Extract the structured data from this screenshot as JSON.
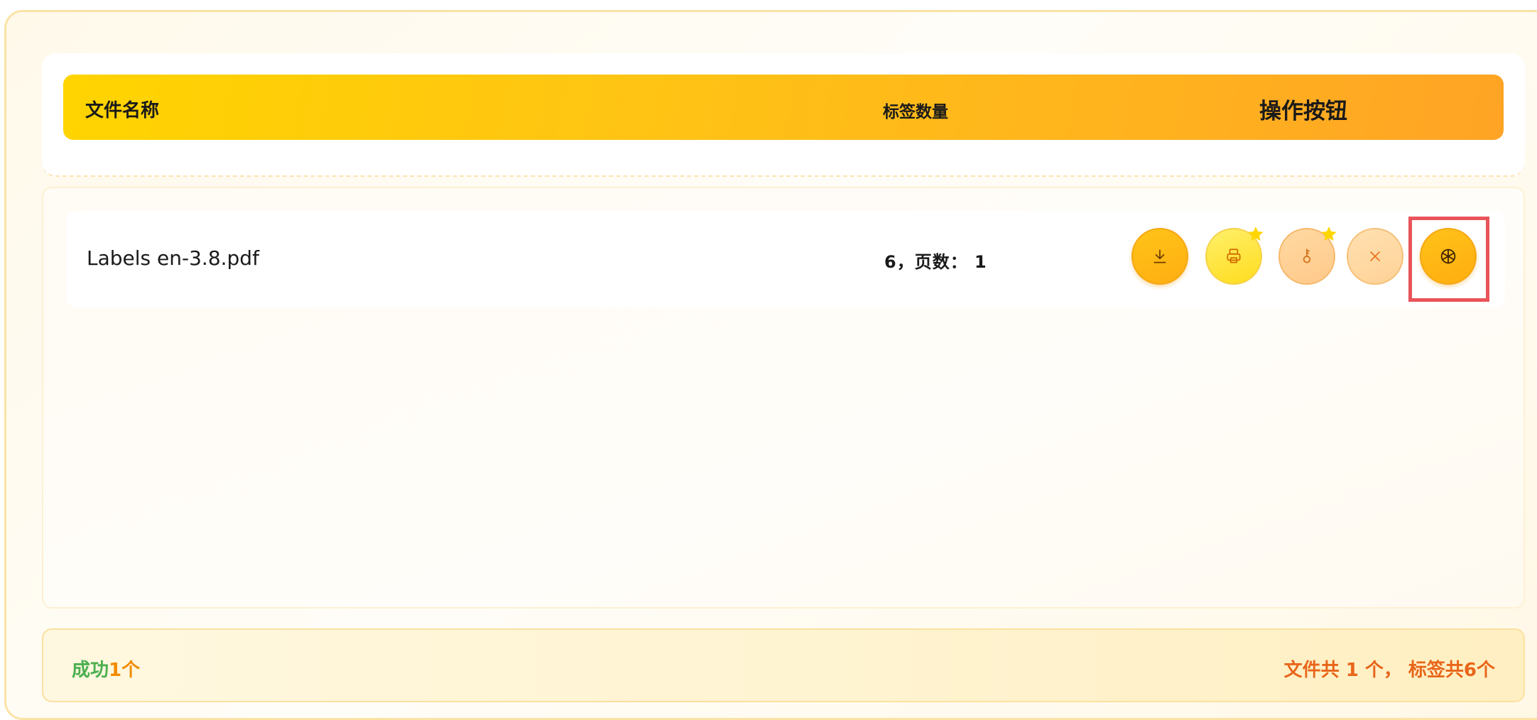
{
  "header": {
    "file_name": "文件名称",
    "label_count": "标签数量",
    "actions": "操作按钮"
  },
  "rows": [
    {
      "file_name": "Labels en-3.8.pdf",
      "count_text": "6，页数： 1"
    }
  ],
  "actions": {
    "download_icon": "download-icon",
    "print_icon": "printer-icon",
    "key_icon": "key-icon",
    "delete_icon": "close-icon",
    "share_icon": "aperture-icon"
  },
  "footer": {
    "success_label": "成功",
    "success_count": "1个",
    "summary": "文件共 1 个， 标签共6个"
  },
  "colors": {
    "header_gradient_start": "#ffd400",
    "header_gradient_end": "#ffa425",
    "success": "#4caf50",
    "summary": "#e8661a",
    "highlight": "#e9545a",
    "star": "#ffd600"
  }
}
